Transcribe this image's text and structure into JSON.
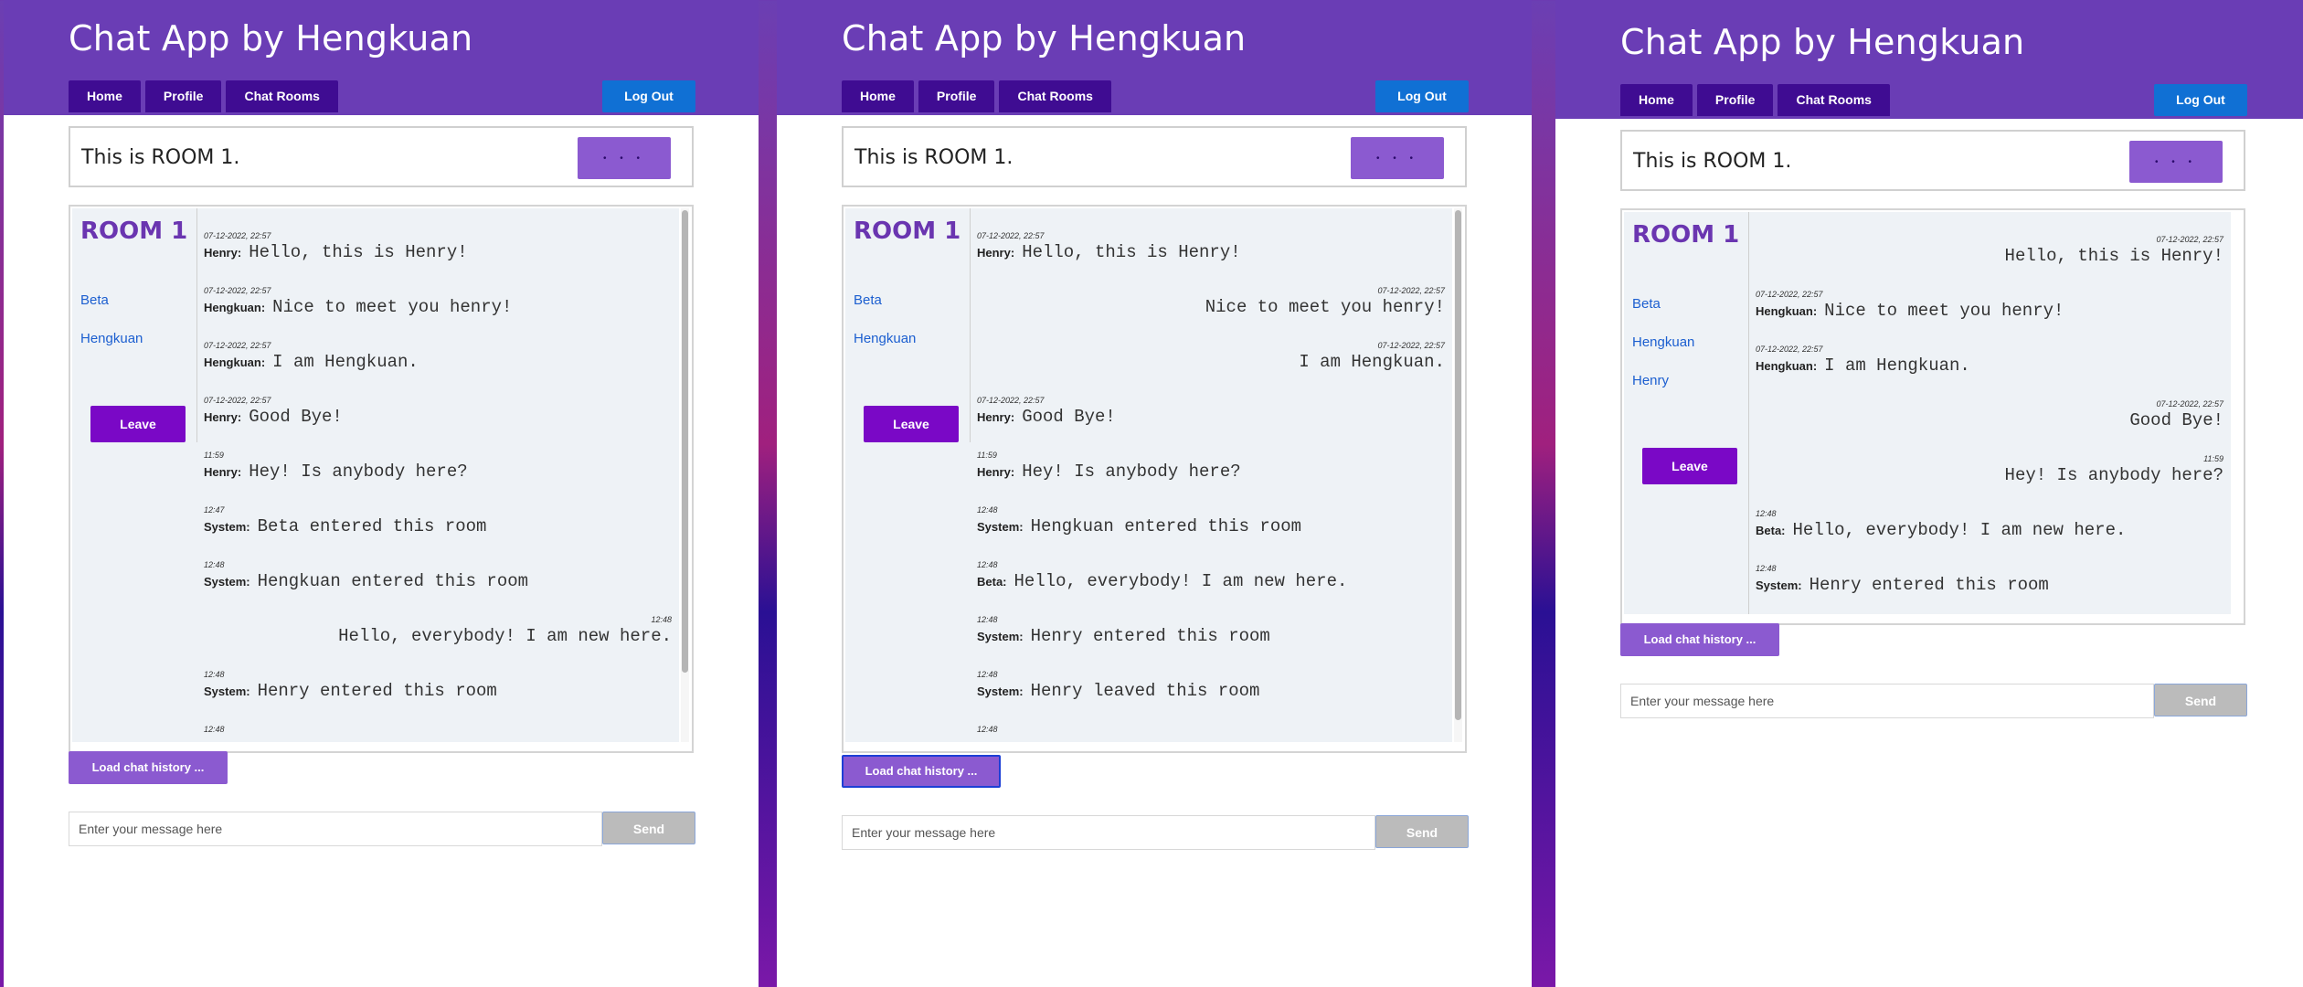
{
  "app": {
    "title": "Chat App by Hengkuan",
    "nav": [
      "Home",
      "Profile",
      "Chat Rooms"
    ],
    "logout_label": "Log Out",
    "room_header_title": "This is ROOM 1.",
    "more_label": "• • •",
    "room_name": "ROOM 1",
    "leave_label": "Leave",
    "load_history_label": "Load chat history ...",
    "message_placeholder": "Enter your message here",
    "send_label": "Send"
  },
  "panels": [
    {
      "members": [
        "Beta",
        "Hengkuan"
      ],
      "messages": [
        {
          "time": "07-12-2022, 22:57",
          "sender": "Henry:",
          "text": "Hello, this is Henry!"
        },
        {
          "time": "07-12-2022, 22:57",
          "sender": "Hengkuan:",
          "text": "Nice to meet you henry!"
        },
        {
          "time": "07-12-2022, 22:57",
          "sender": "Hengkuan:",
          "text": "I am Hengkuan."
        },
        {
          "time": "07-12-2022, 22:57",
          "sender": "Henry:",
          "text": "Good Bye!"
        },
        {
          "time": "11:59",
          "sender": "Henry:",
          "text": "Hey! Is anybody here?"
        },
        {
          "time": "12:47",
          "sender": "System:",
          "text": "Beta entered this room"
        },
        {
          "time": "12:48",
          "sender": "System:",
          "text": "Hengkuan entered this room"
        },
        {
          "time": "12:48",
          "sender": "",
          "text": "Hello, everybody! I am new here.",
          "own": true
        },
        {
          "time": "12:48",
          "sender": "System:",
          "text": "Henry entered this room"
        },
        {
          "time": "12:48",
          "sender": "",
          "text": ""
        }
      ]
    },
    {
      "members": [
        "Beta",
        "Hengkuan"
      ],
      "messages": [
        {
          "time": "07-12-2022, 22:57",
          "sender": "Henry:",
          "text": "Hello, this is Henry!"
        },
        {
          "time": "07-12-2022, 22:57",
          "sender": "",
          "text": "Nice to meet you henry!",
          "own": true
        },
        {
          "time": "07-12-2022, 22:57",
          "sender": "",
          "text": "I am Hengkuan.",
          "own": true
        },
        {
          "time": "07-12-2022, 22:57",
          "sender": "Henry:",
          "text": "Good Bye!"
        },
        {
          "time": "11:59",
          "sender": "Henry:",
          "text": "Hey! Is anybody here?"
        },
        {
          "time": "12:48",
          "sender": "System:",
          "text": "Hengkuan entered this room"
        },
        {
          "time": "12:48",
          "sender": "Beta:",
          "text": "Hello, everybody! I am new here."
        },
        {
          "time": "12:48",
          "sender": "System:",
          "text": "Henry entered this room"
        },
        {
          "time": "12:48",
          "sender": "System:",
          "text": "Henry leaved this room"
        },
        {
          "time": "12:48",
          "sender": "",
          "text": ""
        }
      ]
    },
    {
      "members": [
        "Beta",
        "Hengkuan",
        "Henry"
      ],
      "messages": [
        {
          "time": "07-12-2022, 22:57",
          "sender": "",
          "text": "Hello, this is Henry!",
          "own": true
        },
        {
          "time": "07-12-2022, 22:57",
          "sender": "Hengkuan:",
          "text": "Nice to meet you henry!"
        },
        {
          "time": "07-12-2022, 22:57",
          "sender": "Hengkuan:",
          "text": "I am Hengkuan."
        },
        {
          "time": "07-12-2022, 22:57",
          "sender": "",
          "text": "Good Bye!",
          "own": true
        },
        {
          "time": "11:59",
          "sender": "",
          "text": "Hey! Is anybody here?",
          "own": true
        },
        {
          "time": "12:48",
          "sender": "Beta:",
          "text": "Hello, everybody! I am new here."
        },
        {
          "time": "12:48",
          "sender": "System:",
          "text": "Henry entered this room"
        }
      ]
    }
  ]
}
